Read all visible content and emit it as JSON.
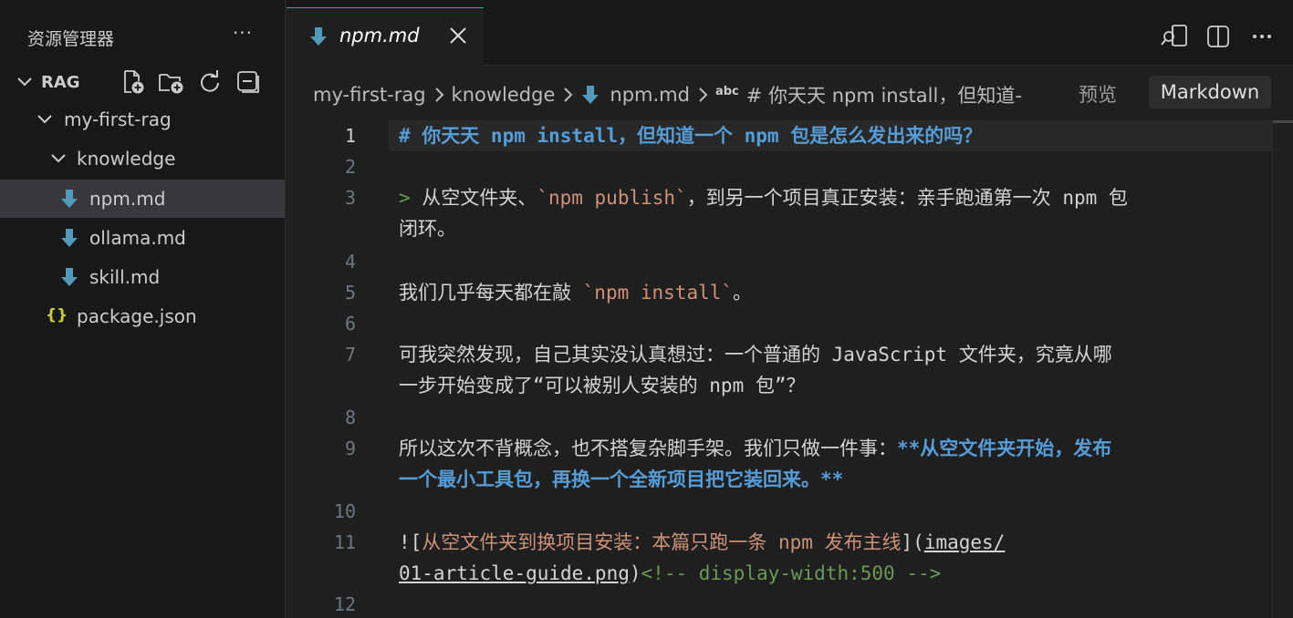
{
  "sidebar": {
    "title": "资源管理器",
    "more_label": "···",
    "section": "RAG",
    "actions": [
      "new-file-icon",
      "new-folder-icon",
      "refresh-icon",
      "collapse-all-icon"
    ],
    "tree": [
      {
        "label": "my-first-rag",
        "type": "folder",
        "expanded": true
      },
      {
        "label": "knowledge",
        "type": "folder",
        "expanded": true
      },
      {
        "label": "npm.md",
        "type": "markdown",
        "selected": true
      },
      {
        "label": "ollama.md",
        "type": "markdown"
      },
      {
        "label": "skill.md",
        "type": "markdown"
      },
      {
        "label": "package.json",
        "type": "json",
        "icon_text": "{}"
      }
    ]
  },
  "tab": {
    "label": "npm.md",
    "close_icon": "close-icon"
  },
  "breadcrumb": {
    "items": [
      "my-first-rag",
      "knowledge",
      "npm.md",
      "# 你天天 npm install，但知道-"
    ],
    "abc_label": "abc"
  },
  "editor_actions": {
    "preview": "预览",
    "markdown": "Markdown"
  },
  "editor": {
    "active_line": 1,
    "line_numbers": [
      "1",
      "2",
      "3",
      "4",
      "5",
      "6",
      "7",
      "8",
      "9",
      "10",
      "11",
      "12"
    ],
    "lines": {
      "l1": "# 你天天 npm install，但知道一个 npm 包是怎么发出来的吗？",
      "l3_marker": ">",
      "l3_a": " 从空文件夹、",
      "l3_code": "`npm publish`",
      "l3_b": "，到另一个项目真正安装：亲手跑通第一次 npm 包",
      "l3_wrap": "闭环。",
      "l5_a": "我们几乎每天都在敲 ",
      "l5_code": "`npm install`",
      "l5_b": "。",
      "l7": "可我突然发现，自己其实没认真想过：一个普通的 JavaScript 文件夹，究竟从哪",
      "l7_wrap": "一步开始变成了“可以被别人安装的 npm 包”？",
      "l9_a": "所以这次不背概念，也不搭复杂脚手架。我们只做一件事：",
      "l9_bold": "**从空文件夹开始，发布",
      "l9_wrap": "一个最小工具包，再换一个全新项目把它装回来。**",
      "l11_open": "![",
      "l11_alt": "从空文件夹到换项目安装：本篇只跑一条 npm 发布主线",
      "l11_mid": "](",
      "l11_url": "images/",
      "l11_url_wrap": "01-article-guide.png",
      "l11_close": ")",
      "l11_comment": "<!-- display-width:500 -->"
    }
  },
  "colors": {
    "background": "#1f1f1f",
    "sidebar": "#181818",
    "selection": "#37373d",
    "heading": "#569cd6",
    "code": "#ce9178",
    "quote": "#6a9955",
    "markdown_file_icon": "#519aba",
    "json_icon": "#cbcb41"
  }
}
